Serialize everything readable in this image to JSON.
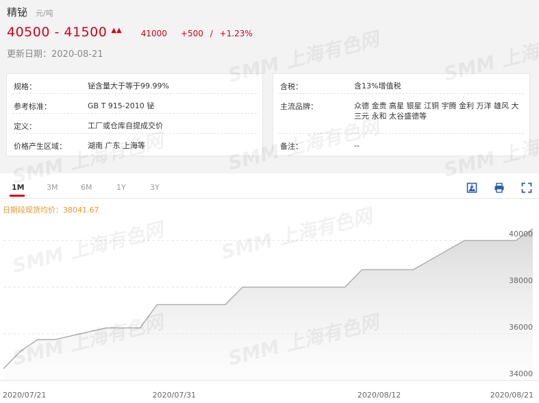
{
  "header": {
    "title": "精铋",
    "unit": "元/吨",
    "price_range": "40500 - 41500",
    "avg_price": "41000",
    "change": "+500",
    "change_sep": "/",
    "change_pct": "+1.23%",
    "date_label": "更新日期：",
    "date": "2020-08-21"
  },
  "specs_left": [
    {
      "label": "规格：",
      "value": "铋含量大于等于99.99%"
    },
    {
      "label": "参考标准：",
      "value": "GB T 915-2010 铋"
    },
    {
      "label": "定义：",
      "value": "工厂或仓库自提成交价"
    },
    {
      "label": "价格产生区域：",
      "value": "湖南 广东 上海等"
    }
  ],
  "specs_right": [
    {
      "label": "含税：",
      "value": "含13%增值税"
    },
    {
      "label": "主流品牌：",
      "value": "众德 金贵 高星 银星 江铜 宇腾 金利 万洋 雄风 大三元 永和 太谷盛德等"
    },
    {
      "label": "备注：",
      "value": "--"
    }
  ],
  "tabs": [
    "1M",
    "3M",
    "6M",
    "1Y",
    "3Y"
  ],
  "active_tab": "1M",
  "watermark": "SMM 上海有色网",
  "chart_data": {
    "type": "line",
    "annotation": "日期段现货均价：38041.67",
    "x": [
      "2020-07-21",
      "2020-07-22",
      "2020-07-23",
      "2020-07-24",
      "2020-07-27",
      "2020-07-28",
      "2020-07-29",
      "2020-07-30",
      "2020-07-31",
      "2020-08-03",
      "2020-08-04",
      "2020-08-05",
      "2020-08-06",
      "2020-08-07",
      "2020-08-10",
      "2020-08-11",
      "2020-08-12",
      "2020-08-13",
      "2020-08-14",
      "2020-08-17",
      "2020-08-18",
      "2020-08-19",
      "2020-08-20",
      "2020-08-21"
    ],
    "values": [
      34500,
      35250,
      35750,
      35750,
      36250,
      36250,
      36250,
      37250,
      37250,
      37250,
      38000,
      38000,
      38000,
      38000,
      38000,
      38750,
      38750,
      38750,
      38750,
      40000,
      40000,
      40000,
      40000,
      40500
    ],
    "x_tick_labels": [
      "2020/07/21",
      "2020/07/31",
      "2020/08/12",
      "2020/08/21"
    ],
    "x_tick_dates": [
      "2020-07-21",
      "2020-07-31",
      "2020-08-12",
      "2020-08-21"
    ],
    "y_ticks": [
      34000,
      36000,
      38000,
      40000
    ],
    "ylim": [
      34000,
      41200
    ],
    "grid": "horizontal dashed",
    "colors": {
      "line": "#aaaaaa",
      "area_top": "#d6d6d6",
      "area_bottom": "#f7f7f7",
      "accent": "#d0021b",
      "annotation": "#e8952b"
    }
  }
}
